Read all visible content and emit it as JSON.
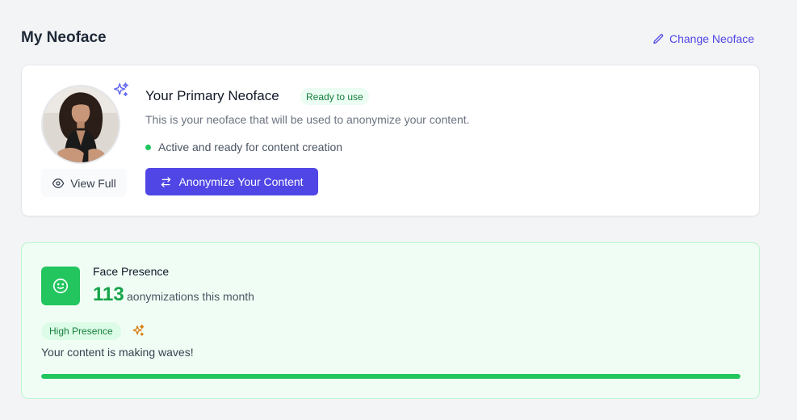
{
  "header": {
    "title": "My Neoface",
    "change_label": "Change Neoface"
  },
  "primary": {
    "title": "Your Primary Neoface",
    "badge": "Ready to use",
    "description": "This is your neoface that will be used to anonymize your content.",
    "status": "Active and ready for content creation",
    "view_full_label": "View Full",
    "cta_label": "Anonymize Your Content"
  },
  "presence": {
    "label": "Face Presence",
    "count": "113",
    "count_label": "aonymizations this month",
    "level_badge": "High Presence",
    "message": "Your content is making waves!",
    "progress": 1.0
  },
  "colors": {
    "accent": "#4f46e5",
    "success": "#22c55e",
    "success_text": "#16a34a",
    "sparkle": "#d97706"
  },
  "icons": {
    "change": "pencil-icon",
    "sparkle": "sparkles-icon",
    "view": "eye-icon",
    "cta": "swap-arrows-icon",
    "presence": "smile-icon"
  }
}
